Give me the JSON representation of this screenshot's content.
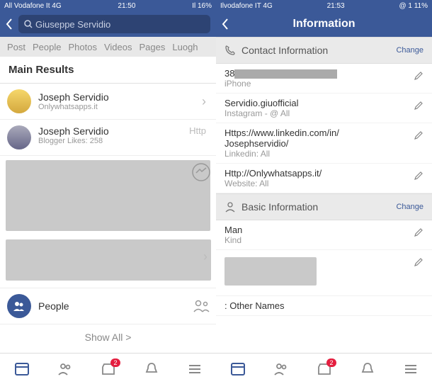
{
  "left": {
    "status": {
      "carrier": "All Vodafone It 4G",
      "time": "21:50",
      "battery": "Il 16%"
    },
    "search": {
      "query": "Giuseppe Servidio"
    },
    "tabs": [
      "Post",
      "People",
      "Photos",
      "Videos",
      "Pages",
      "Luogh"
    ],
    "mainResults": "Main Results",
    "results": [
      {
        "name": "Joseph Servidio",
        "sub": "Onlywhatsapps.it"
      },
      {
        "name": "Joseph Servidio",
        "sub": "Blogger Likes: 258"
      }
    ],
    "httpLabel": "Http",
    "peopleLabel": "People",
    "showAll": "Show All  >",
    "navBadge": "2"
  },
  "right": {
    "status": {
      "carrier": "Ilvodafone IT 4G",
      "time": "21:53",
      "battery": "@ 1 11%"
    },
    "title": "Information",
    "contactSection": "Contact Information",
    "change": "Change",
    "phone": {
      "prefix": "38",
      "label": "iPhone"
    },
    "insta": {
      "value": "Servidio.giuofficial",
      "label": "Instagram - @ All"
    },
    "linkedin": {
      "url": "Https://www.linkedin.com/in/",
      "user": "Josephservidio/",
      "label": "Linkedin: All"
    },
    "website": {
      "url": "Http://Onlywhatsapps.it/",
      "label": "Website: All"
    },
    "basicSection": "Basic Information",
    "gender": {
      "value": "Man",
      "label": "Kind"
    },
    "otherNames": ": Other Names",
    "navBadge": "2"
  }
}
